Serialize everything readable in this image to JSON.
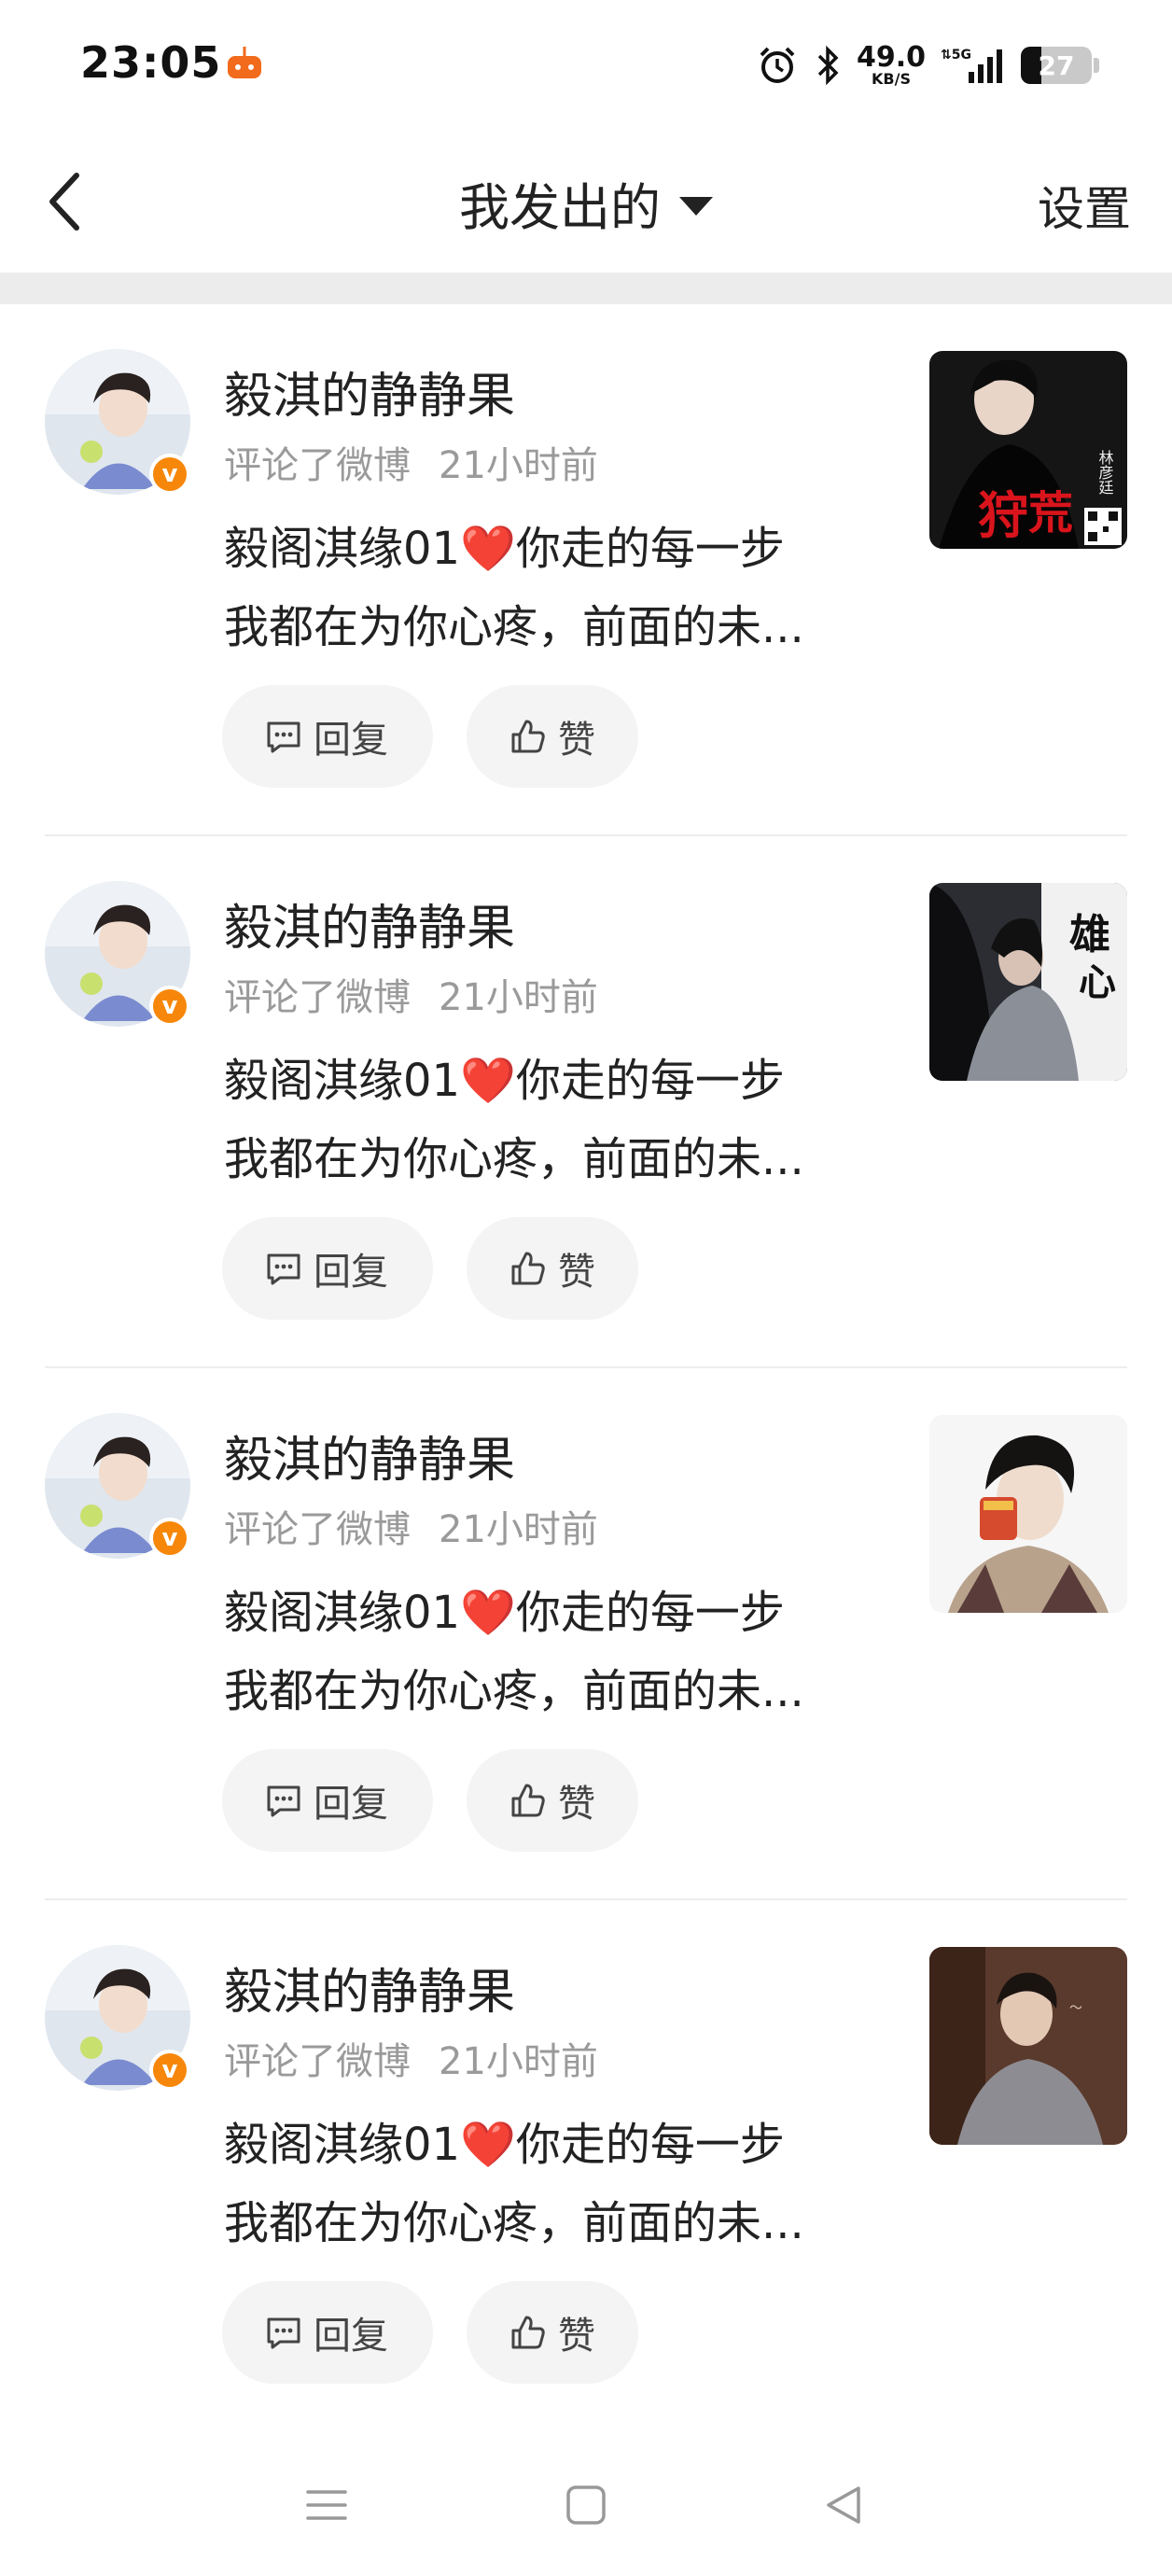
{
  "status_bar": {
    "time": "23:05",
    "net_speed": "49.0",
    "net_unit": "KB/S",
    "signal_label": "5G",
    "battery": "27",
    "icons": [
      "alarm-icon",
      "bluetooth-icon",
      "signal-icon",
      "battery-icon"
    ]
  },
  "header": {
    "title": "我发出的",
    "settings_label": "设置"
  },
  "feed": [
    {
      "username": "毅淇的静静果",
      "action": "评论了微博",
      "time": "21小时前",
      "line1_pre": "毅阁淇缘01",
      "line1_heart": "❤️",
      "line1_post": "你走的每一步",
      "line2": "我都在为你心疼，前面的未...",
      "reply_label": "回复",
      "like_label": "赞",
      "thumb_text_1": "狩",
      "thumb_text_2": "荒",
      "thumb_credit": "林彦廷"
    },
    {
      "username": "毅淇的静静果",
      "action": "评论了微博",
      "time": "21小时前",
      "line1_pre": "毅阁淇缘01",
      "line1_heart": "❤️",
      "line1_post": "你走的每一步",
      "line2": "我都在为你心疼，前面的未...",
      "reply_label": "回复",
      "like_label": "赞",
      "thumb_text_1": "雄",
      "thumb_text_2": "心"
    },
    {
      "username": "毅淇的静静果",
      "action": "评论了微博",
      "time": "21小时前",
      "line1_pre": "毅阁淇缘01",
      "line1_heart": "❤️",
      "line1_post": "你走的每一步",
      "line2": "我都在为你心疼，前面的未...",
      "reply_label": "回复",
      "like_label": "赞"
    },
    {
      "username": "毅淇的静静果",
      "action": "评论了微博",
      "time": "21小时前",
      "line1_pre": "毅阁淇缘01",
      "line1_heart": "❤️",
      "line1_post": "你走的每一步",
      "line2": "我都在为你心疼，前面的未...",
      "reply_label": "回复",
      "like_label": "赞"
    }
  ],
  "colors": {
    "accent_badge": "#f7870a",
    "meta_text": "#9a9a9a",
    "pill_bg": "#f4f4f4",
    "heart": "#e8202c"
  },
  "system_nav": [
    "menu-icon",
    "home-icon",
    "back-triangle-icon"
  ]
}
